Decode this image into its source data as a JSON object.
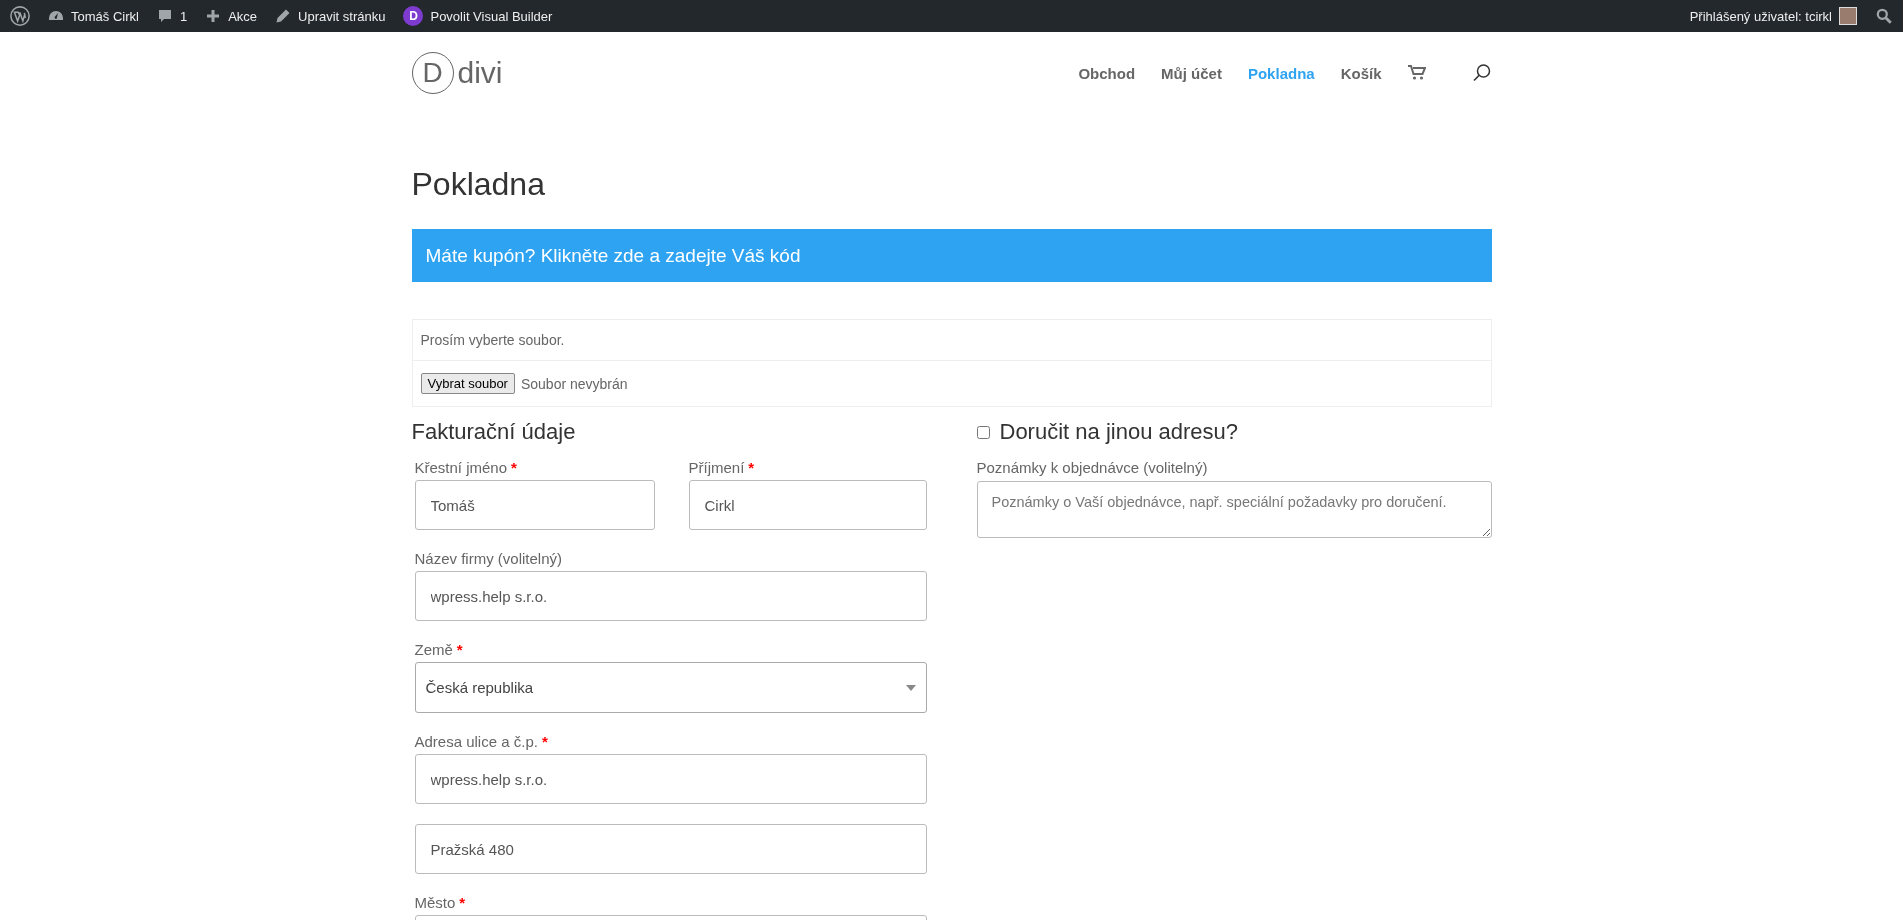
{
  "admin_bar": {
    "items": [
      {
        "kind": "wp"
      },
      {
        "kind": "dashboard",
        "label": "Tomáš Cirkl"
      },
      {
        "kind": "comments",
        "label": "1"
      },
      {
        "kind": "new",
        "label": "Akce"
      },
      {
        "kind": "edit",
        "label": "Upravit stránku"
      },
      {
        "kind": "builder",
        "letter": "D",
        "label": "Povolit Visual Builder"
      }
    ],
    "account": "Přihlášený uživatel: tcirkl"
  },
  "header": {
    "logo": {
      "letter": "D",
      "text": "divi"
    },
    "nav": [
      {
        "label": "Obchod",
        "selected": false
      },
      {
        "label": "Můj účet",
        "selected": false
      },
      {
        "label": "Pokladna",
        "selected": true
      },
      {
        "label": "Košík",
        "selected": false
      }
    ]
  },
  "page_title": "Pokladna",
  "coupon_notice": "Máte kupón? Klikněte zde a zadejte Váš kód",
  "upload": {
    "prompt": "Prosím vyberte soubor.",
    "button": "Vybrat soubor",
    "status": "Soubor nevybrán"
  },
  "required_mark": "*",
  "billing": {
    "title": "Fakturační údaje",
    "fields": [
      {
        "kind": "half",
        "label": "Křestní jméno",
        "required": true,
        "value": "Tomáš"
      },
      {
        "kind": "half",
        "label": "Příjmení",
        "required": true,
        "value": "Cirkl"
      },
      {
        "kind": "text",
        "label": "Název firmy (volitelný)",
        "required": false,
        "value": "wpress.help s.r.o."
      },
      {
        "kind": "select",
        "label": "Země",
        "required": true,
        "value": "Česká republika"
      },
      {
        "kind": "text",
        "label": "Adresa ulice a č.p.",
        "required": true,
        "value": "wpress.help s.r.o."
      },
      {
        "kind": "text",
        "value": "Pražská 480"
      },
      {
        "kind": "text",
        "label": "Město",
        "required": true
      }
    ]
  },
  "shipping": {
    "label": "Doručit na jinou adresu?",
    "checked": false,
    "notes": {
      "label": "Poznámky k objednávce (volitelný)",
      "placeholder": "Poznámky o Vaší objednávce, např. speciální požadavky pro doručení."
    }
  }
}
